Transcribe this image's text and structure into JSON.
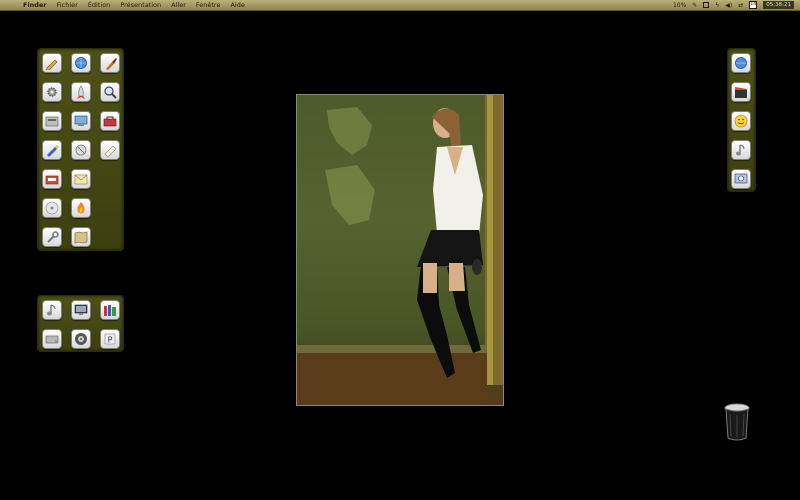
{
  "menubar": {
    "apple_icon": "apple-icon",
    "items": [
      "Finder",
      "Fichier",
      "Édition",
      "Présentation",
      "Aller",
      "Fenêtre",
      "Aide"
    ],
    "extras": {
      "battery_percent": "10%",
      "date_day": "14",
      "clock": "05:38:21"
    }
  },
  "shelves": {
    "left_top": [
      "pencil-tool-icon",
      "globe-magnifier-icon",
      "paintbrush-icon",
      "gear-icon",
      "rocket-icon",
      "magnifier-icon",
      "disk-drive-icon",
      "network-globe-icon",
      "toolbox-icon",
      "marker-pen-icon",
      "satellite-icon",
      "tube-icon",
      "red-box-icon",
      "envelope-icon",
      "",
      "cd-disc-icon",
      "flame-icon",
      "",
      "wrench-icon",
      "map-icon",
      ""
    ],
    "left_bottom": [
      "music-note-icon",
      "monitor-icon",
      "books-icon",
      "hard-drive-icon",
      "wheel-icon",
      "p-key-icon"
    ],
    "right": [
      "finder-globe-icon",
      "clapper-icon",
      "smiley-icon",
      "music-note-icon",
      "magnifier-globe-icon"
    ]
  },
  "colors": {
    "menubar": "#b9b17a",
    "shelf": "#4e5216",
    "desktop": "#000000"
  },
  "desktop_items": {
    "photo": "desktop-photo",
    "trash": "trash-icon"
  }
}
